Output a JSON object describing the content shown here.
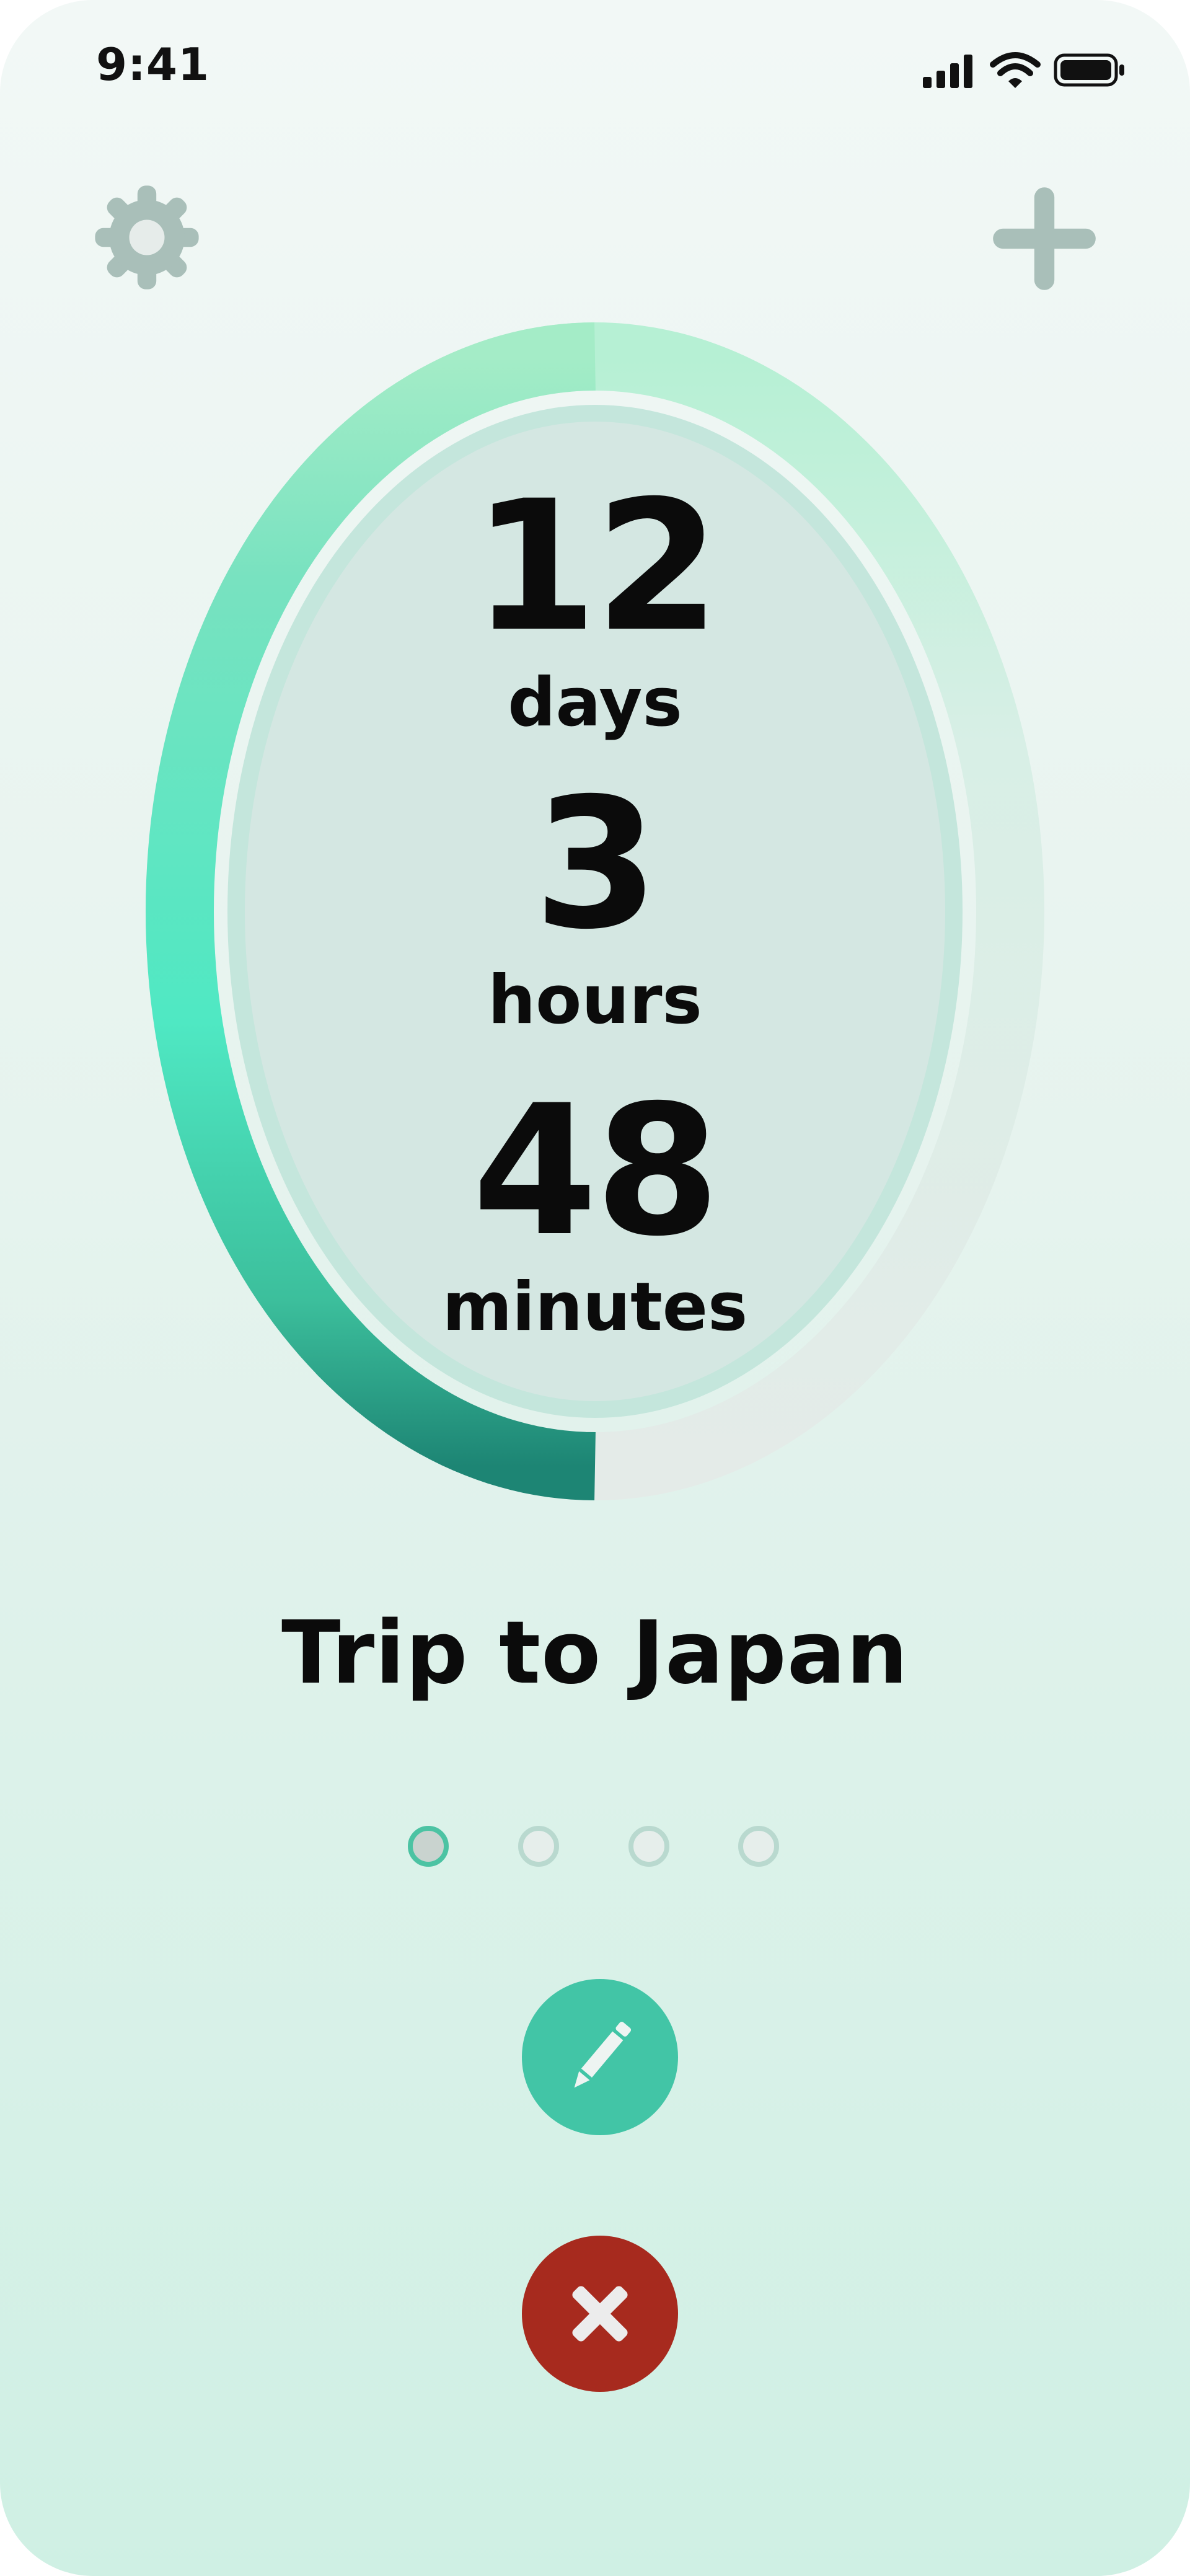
{
  "status_bar": {
    "time": "9:41",
    "icons": [
      "cellular-signal-icon",
      "wifi-icon",
      "battery-icon"
    ]
  },
  "header": {
    "settings_icon": "gear-icon",
    "add_icon": "plus-icon"
  },
  "countdown": {
    "days_value": "12",
    "days_label": "days",
    "hours_value": "3",
    "hours_label": "hours",
    "minutes_value": "48",
    "minutes_label": "minutes",
    "progress_fraction": 0.5
  },
  "event": {
    "title": "Trip to Japan"
  },
  "pager": {
    "count": 4,
    "active_index": 0
  },
  "actions": {
    "edit_icon": "pencil-icon",
    "delete_icon": "close-icon"
  },
  "colors": {
    "accent": "#42c5a6",
    "danger": "#a72a1e",
    "icon_gray": "#a9bfb9",
    "text": "#0b0b0b"
  }
}
